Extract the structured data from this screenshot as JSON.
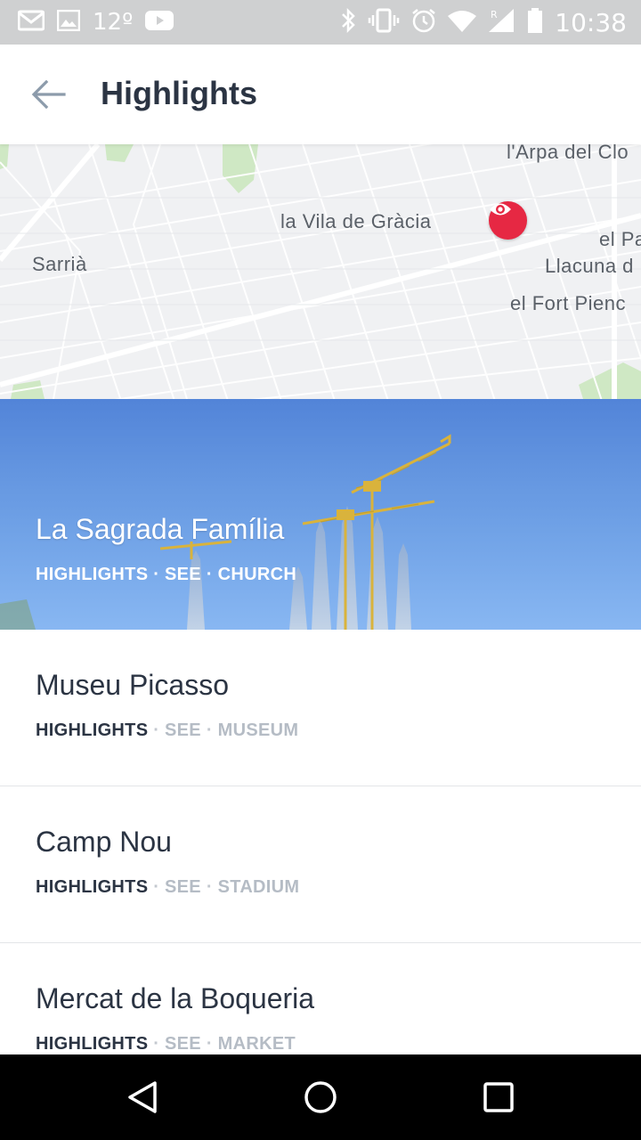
{
  "status_bar": {
    "temperature": "12º",
    "time": "10:38",
    "icons": [
      "gmail-icon",
      "gallery-icon",
      "youtube-icon",
      "bluetooth-icon",
      "vibrate-icon",
      "alarm-icon",
      "wifi-icon",
      "signal-icon",
      "battery-icon"
    ]
  },
  "app_bar": {
    "title": "Highlights",
    "back_icon": "arrow-left-icon"
  },
  "map": {
    "labels": [
      "l'Arpa del Clo",
      "la Vila de Gràcia",
      "el Pa",
      "Sarrià",
      "Llacuna d",
      "el Fort Pienc"
    ],
    "marker_icon": "eye-icon",
    "colors": {
      "background": "#f0f1f3",
      "park": "#cfe8c4",
      "marker": "#e62843"
    }
  },
  "featured": {
    "title": "La Sagrada Família",
    "meta": [
      "HIGHLIGHTS",
      "SEE",
      "CHURCH"
    ]
  },
  "items": [
    {
      "title": "Museu Picasso",
      "meta": [
        "HIGHLIGHTS",
        "SEE",
        "MUSEUM"
      ]
    },
    {
      "title": "Camp Nou",
      "meta": [
        "HIGHLIGHTS",
        "SEE",
        "STADIUM"
      ]
    },
    {
      "title": "Mercat de la Boqueria",
      "meta": [
        "HIGHLIGHTS",
        "SEE",
        "MARKET"
      ]
    }
  ],
  "separator": "·",
  "nav_bar": {
    "icons": [
      "back-triangle-icon",
      "home-circle-icon",
      "recents-square-icon"
    ]
  }
}
